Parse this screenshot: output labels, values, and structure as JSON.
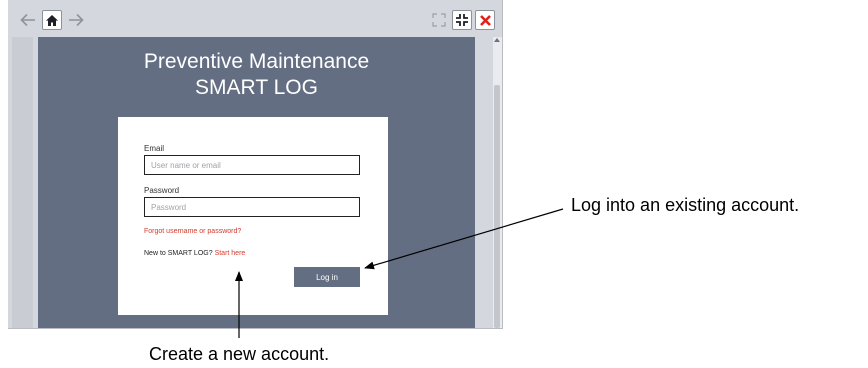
{
  "header": {
    "title_line1": "Preventive Maintenance",
    "title_line2": "SMART LOG"
  },
  "toolbar": {
    "buttons": [
      "back-arrow-icon",
      "home-icon",
      "forward-arrow-icon",
      "expand-icon",
      "collapse-icon",
      "close-icon"
    ],
    "close_color": "#e0211b"
  },
  "form": {
    "email_label": "Email",
    "email_placeholder": "User name or email",
    "password_label": "Password",
    "password_placeholder": "Password",
    "forgot_link": "Forgot username or password?",
    "new_user_prompt": "New to SMART LOG?",
    "start_here_link": "Start here",
    "login_button": "Log in"
  },
  "annotations": {
    "login_callout": "Log into an existing account.",
    "create_callout": "Create a new account."
  },
  "colors": {
    "panel": "#636e82",
    "link": "#d23b2f"
  }
}
